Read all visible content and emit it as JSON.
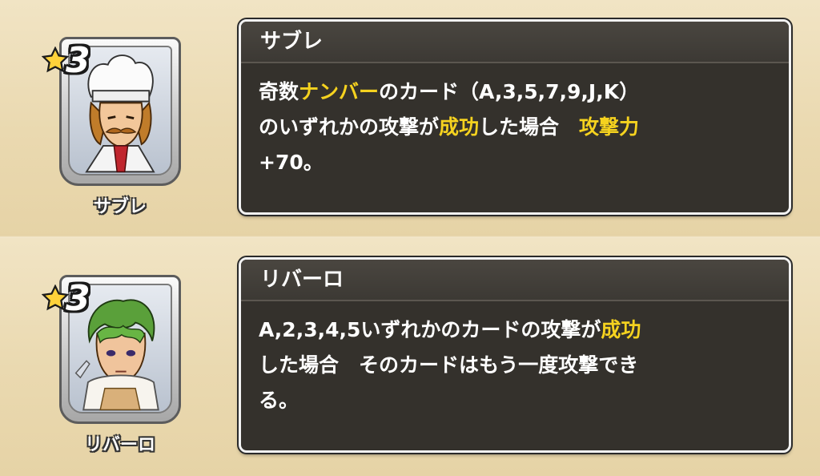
{
  "cards": [
    {
      "rarity": "3",
      "portrait_name": "サブレ",
      "title": "サブレ",
      "desc": {
        "l1_a": "奇数",
        "l1_b": "ナンバー",
        "l1_c": "のカード（A,3,5,7,9,J,K）",
        "l2_a": "のいずれかの攻撃が",
        "l2_b": "成功",
        "l2_c": "した場合　",
        "l2_d": "攻撃力",
        "l3_a": "+70。"
      }
    },
    {
      "rarity": "3",
      "portrait_name": "リバーロ",
      "title": "リバーロ",
      "desc": {
        "l1_a": "A,2,3,4,5いずれかのカードの攻撃が",
        "l1_b": "成功",
        "l2_a": "した場合　そのカードはもう一度攻撃でき",
        "l3_a": "る。"
      }
    }
  ],
  "colors": {
    "highlight": "#f5d21f",
    "panel": "#34312c",
    "background": "#efe1bf"
  },
  "icons": [
    "star-icon",
    "chef-portrait",
    "green-hair-portrait"
  ]
}
